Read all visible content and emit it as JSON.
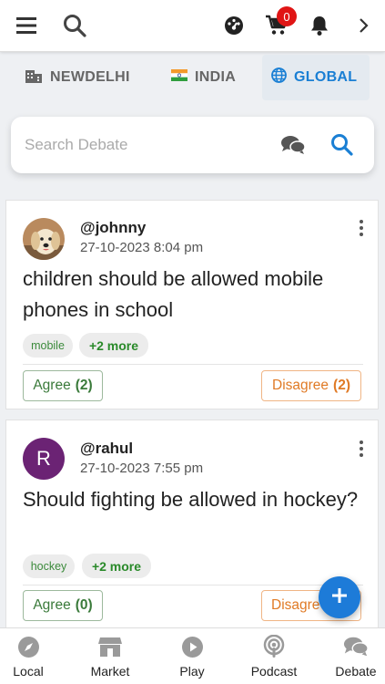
{
  "header": {
    "cart_count": "0",
    "icons": [
      "menu-icon",
      "search-icon",
      "dashboard-icon",
      "cart-icon",
      "bell-icon",
      "chevron-right-icon"
    ]
  },
  "location_tabs": [
    {
      "label": "NEWDELHI",
      "icon": "city-icon",
      "active": false
    },
    {
      "label": "INDIA",
      "icon": "india-flag-icon",
      "active": false
    },
    {
      "label": "GLOBAL",
      "icon": "globe-icon",
      "active": true
    }
  ],
  "search": {
    "placeholder": "Search Debate"
  },
  "debates": [
    {
      "username": "@johnny",
      "date": "27-10-2023 8:04 pm",
      "question": "children should be allowed mobile phones in school",
      "tag": "mobile",
      "more_tags": "+2 more",
      "agree_label": "Agree",
      "agree_count": "(2)",
      "disagree_label": "Disagree",
      "disagree_count": "(2)"
    },
    {
      "username": "@rahul",
      "avatar_letter": "R",
      "avatar_color": "#6b2374",
      "date": "27-10-2023 7:55 pm",
      "question": "Should fighting be allowed in hockey?",
      "tag": "hockey",
      "more_tags": "+2 more",
      "agree_label": "Agree",
      "agree_count": "(0)",
      "disagree_label": "Disagre"
    }
  ],
  "bottom_nav": [
    {
      "label": "Local",
      "icon": "compass-icon"
    },
    {
      "label": "Market",
      "icon": "store-icon"
    },
    {
      "label": "Play",
      "icon": "play-icon"
    },
    {
      "label": "Podcast",
      "icon": "podcast-icon"
    },
    {
      "label": "Debate",
      "icon": "chat-bubbles-icon"
    }
  ],
  "colors": {
    "accent": "#1a7fd4",
    "agree": "#3a7a3a",
    "disagree": "#e07a25",
    "badge": "#e01515"
  }
}
